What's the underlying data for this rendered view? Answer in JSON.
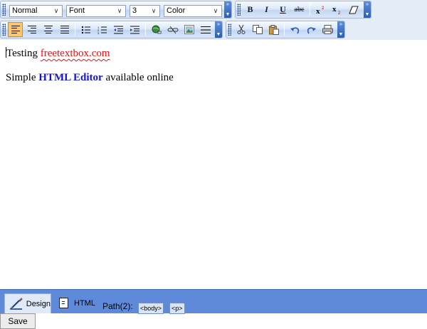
{
  "toolbar": {
    "format_select": "Normal",
    "font_select": "Font",
    "size_select": "3",
    "color_select": "Color",
    "bold": "B",
    "italic": "I",
    "underline": "U",
    "strike": "abc"
  },
  "content": {
    "line1_prefix": "Testing ",
    "line1_link": "freetextbox.com",
    "line2_prefix": "Simple ",
    "line2_bold": "HTML Editor",
    "line2_suffix": " available online"
  },
  "tabs": {
    "design": "Design",
    "html": "HTML"
  },
  "path": {
    "label": "Path(2):",
    "tags": [
      "<body>",
      "<p>"
    ]
  },
  "save": "Save",
  "colors": {
    "link_red": "#e01010",
    "editor_blue": "#1515c8",
    "bar_blue": "#5f8ad9",
    "active_button": "#ffc670"
  }
}
